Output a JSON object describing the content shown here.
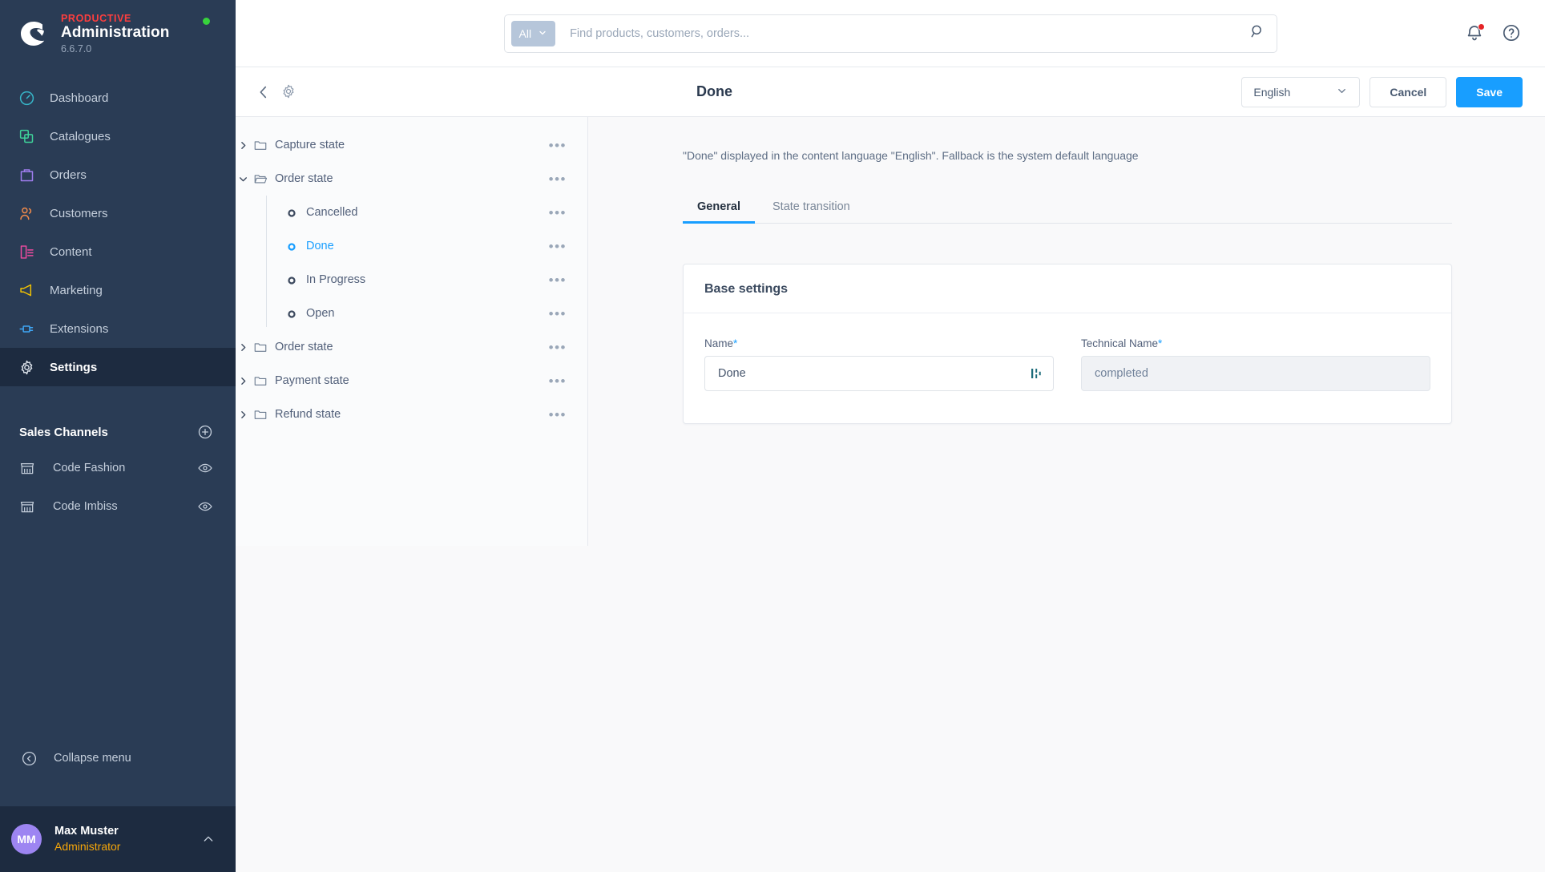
{
  "brand": {
    "kicker": "PRODUCTIVE",
    "title": "Administration",
    "version": "6.6.7.0",
    "status_color": "#37d33c",
    "accent_color": "#189eff"
  },
  "sidebar": {
    "items": [
      {
        "label": "Dashboard",
        "icon": "speedometer-icon",
        "color": "#37b6c9",
        "active": false
      },
      {
        "label": "Catalogues",
        "icon": "catalogue-icon",
        "color": "#3fd29a",
        "active": false
      },
      {
        "label": "Orders",
        "icon": "bag-icon",
        "color": "#a07ef0",
        "active": false
      },
      {
        "label": "Customers",
        "icon": "customers-icon",
        "color": "#f08a4b",
        "active": false
      },
      {
        "label": "Content",
        "icon": "content-icon",
        "color": "#ef4ba0",
        "active": false
      },
      {
        "label": "Marketing",
        "icon": "megaphone-icon",
        "color": "#f2c200",
        "active": false
      },
      {
        "label": "Extensions",
        "icon": "plug-icon",
        "color": "#3fa7f5",
        "active": false
      },
      {
        "label": "Settings",
        "icon": "gear-icon",
        "color": "#dfe5ed",
        "active": true
      }
    ],
    "sales_channels": {
      "title": "Sales Channels",
      "add_label": "+",
      "items": [
        {
          "label": "Code Fashion"
        },
        {
          "label": "Code Imbiss"
        }
      ]
    },
    "collapse_label": "Collapse menu",
    "user": {
      "initials": "MM",
      "name": "Max Muster",
      "role": "Administrator",
      "avatar_color": "#9d85f2",
      "role_color": "#f6a609"
    }
  },
  "topbar": {
    "search": {
      "scope_label": "All",
      "placeholder": "Find products, customers, orders...",
      "value": ""
    },
    "notifications_icon": "bell-icon",
    "has_notification": true,
    "help_icon": "help-circle-icon"
  },
  "toolbar": {
    "back_icon": "chevron-left-icon",
    "settings_icon": "gear-icon",
    "title": "Done",
    "language": "English",
    "cancel_label": "Cancel",
    "save_label": "Save"
  },
  "tree": {
    "nodes": [
      {
        "label": "Capture state",
        "type": "folder",
        "expanded": false,
        "selected": false
      },
      {
        "label": "Order state",
        "type": "folder",
        "expanded": true,
        "selected": false,
        "children": [
          {
            "label": "Cancelled",
            "type": "leaf",
            "selected": false
          },
          {
            "label": "Done",
            "type": "leaf",
            "selected": true
          },
          {
            "label": "In Progress",
            "type": "leaf",
            "selected": false
          },
          {
            "label": "Open",
            "type": "leaf",
            "selected": false
          }
        ]
      },
      {
        "label": "Order state",
        "type": "folder",
        "expanded": false,
        "selected": false
      },
      {
        "label": "Payment state",
        "type": "folder",
        "expanded": false,
        "selected": false
      },
      {
        "label": "Refund state",
        "type": "folder",
        "expanded": false,
        "selected": false
      }
    ],
    "context_menu_glyph": "•••"
  },
  "detail": {
    "fallback_note": "\"Done\" displayed in the content language \"English\". Fallback is the system default language",
    "tabs": [
      {
        "label": "General",
        "active": true
      },
      {
        "label": "State transition",
        "active": false
      }
    ],
    "card": {
      "title": "Base settings",
      "fields": [
        {
          "label": "Name",
          "required_mark": "*",
          "value": "Done",
          "disabled": false,
          "trailing_icon": "inheritance-icon"
        },
        {
          "label": "Technical Name",
          "required_mark": "*",
          "value": "completed",
          "disabled": true,
          "trailing_icon": ""
        }
      ]
    }
  }
}
